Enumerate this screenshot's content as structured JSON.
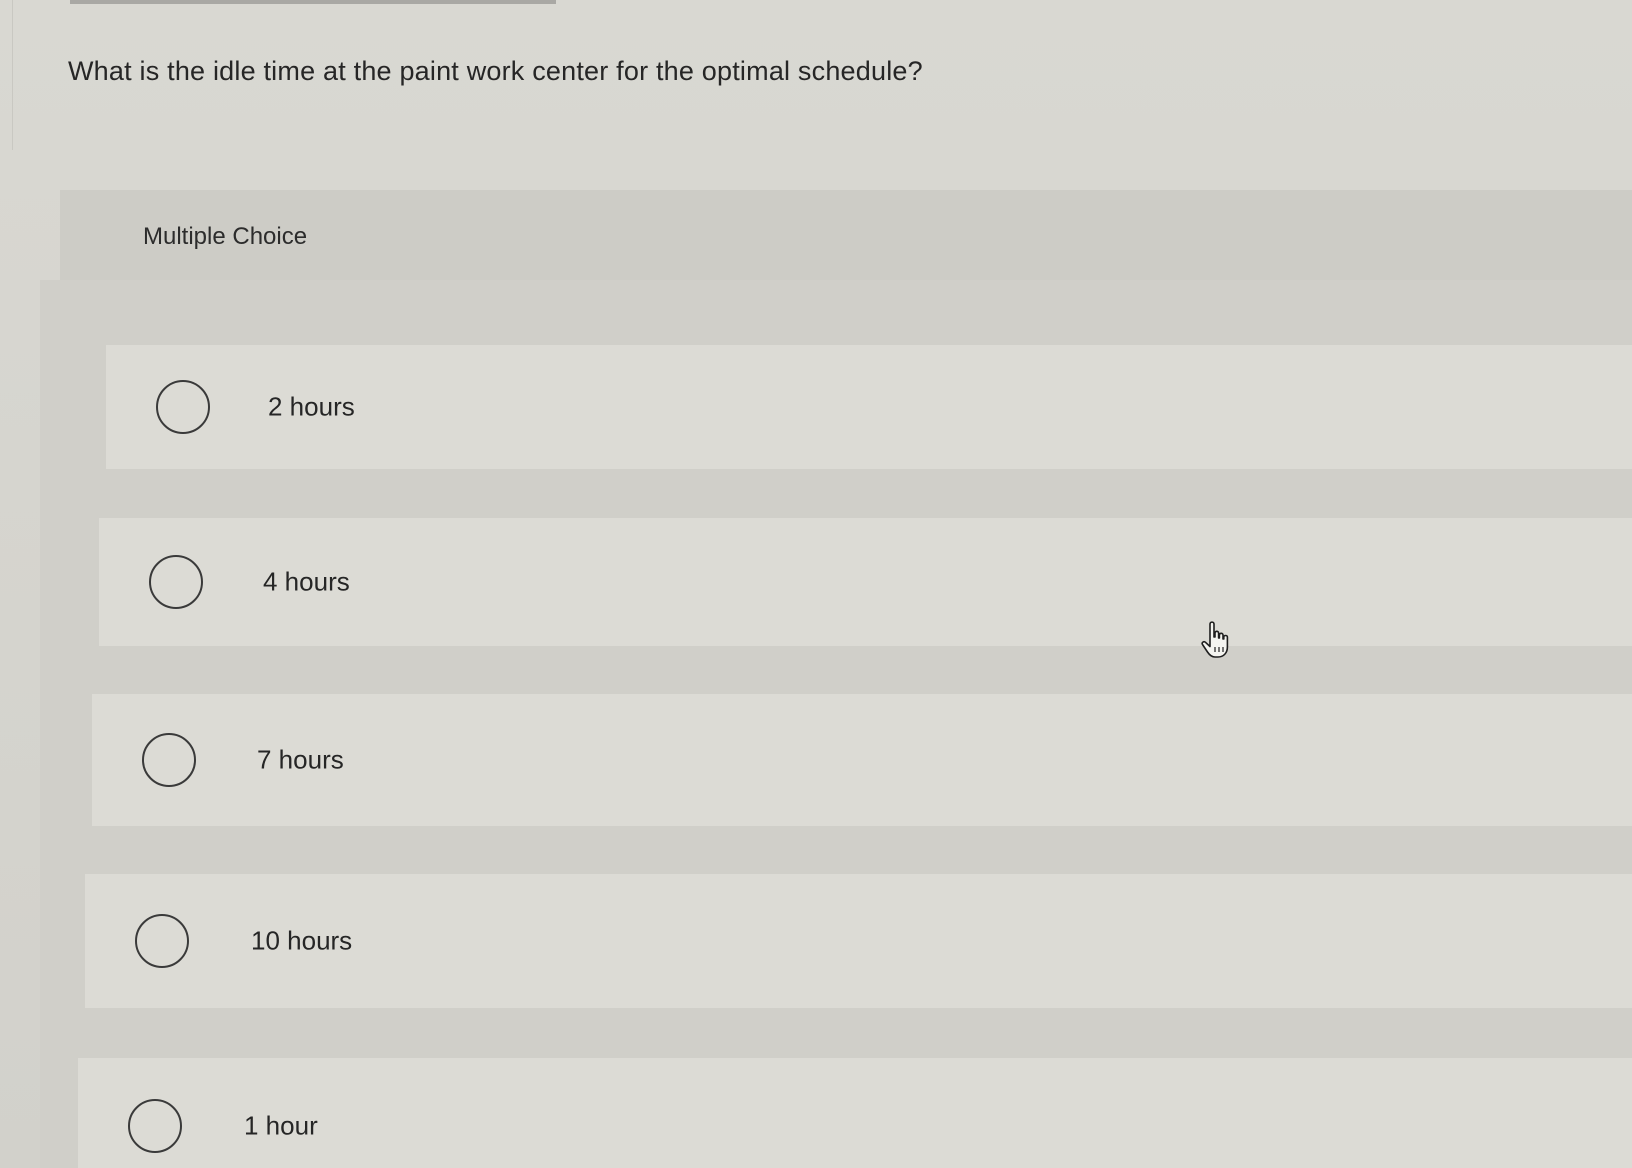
{
  "question": {
    "text": "What is the idle time at the paint work center for the optimal schedule?"
  },
  "section": {
    "label": "Multiple Choice"
  },
  "choices": [
    {
      "label": "2 hours",
      "selected": false
    },
    {
      "label": "4 hours",
      "selected": false
    },
    {
      "label": "7 hours",
      "selected": false
    },
    {
      "label": "10 hours",
      "selected": false
    },
    {
      "label": "1 hour",
      "selected": false
    }
  ],
  "cursor": {
    "icon": "hand-pointer-icon"
  },
  "colors": {
    "background": "#d6d5cf",
    "panel": "#cdccc6",
    "choice": "#dcdbd5",
    "text": "#262626"
  }
}
